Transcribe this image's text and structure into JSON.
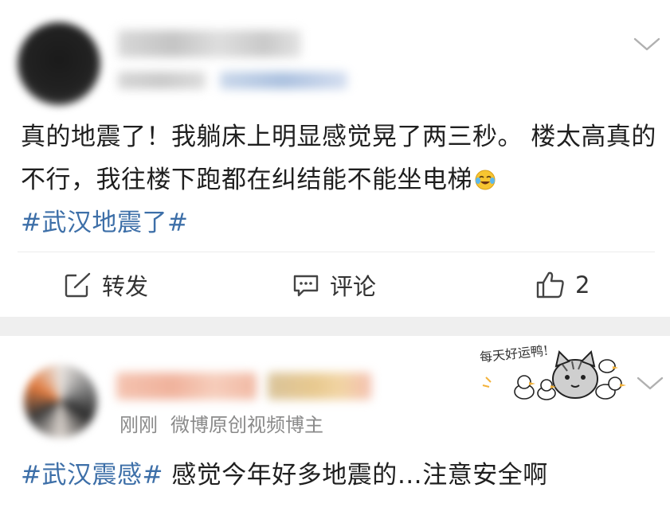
{
  "post1": {
    "text_plain": "真的地震了！我躺床上明显感觉晃了两三秒。 楼太高真的不行，我往楼下跑都在纠结能不能坐电梯",
    "hashtag": "#武汉地震了#",
    "actions": {
      "forward_label": "转发",
      "comment_label": "评论",
      "like_count": "2"
    }
  },
  "post2": {
    "meta": {
      "time": "刚刚",
      "badge": "微博原创视频博主"
    },
    "hashtag": "#武汉震感#",
    "text_plain": " 感觉今年好多地震的…注意安全啊",
    "sticker_text": "每天好运鸭!"
  },
  "colors": {
    "hashtag": "#3d6fa8",
    "separator": "#efefef",
    "meta_text": "#8a8a8a"
  },
  "icons": {
    "forward": "edit-share-icon",
    "comment": "comment-bubble-icon",
    "like": "thumbs-up-icon",
    "more": "chevron-down-icon",
    "emoji": "laugh-cry-emoji-icon"
  }
}
